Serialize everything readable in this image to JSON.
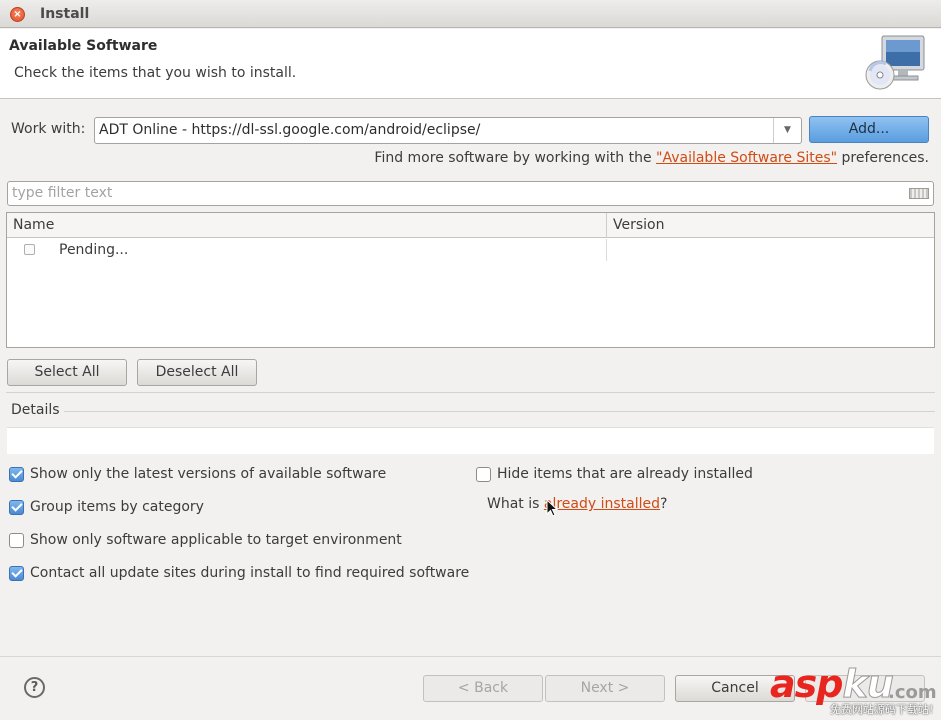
{
  "window": {
    "title": "Install"
  },
  "header": {
    "title": "Available Software",
    "description": "Check the items that you wish to install."
  },
  "work_with": {
    "label": "Work with:",
    "value": "ADT Online - https://dl-ssl.google.com/android/eclipse/",
    "add_button": "Add..."
  },
  "more_software": {
    "prefix": "Find more software by working with the ",
    "link": "\"Available Software Sites\"",
    "suffix": " preferences."
  },
  "filter": {
    "placeholder": "type filter text"
  },
  "table": {
    "columns": [
      "Name",
      "Version"
    ],
    "rows": [
      {
        "name": "Pending...",
        "version": ""
      }
    ]
  },
  "selection_buttons": {
    "select_all": "Select All",
    "deselect_all": "Deselect All"
  },
  "details": {
    "label": "Details"
  },
  "options": {
    "latest_versions": {
      "label": "Show only the latest versions of available software",
      "checked": true
    },
    "group_by_category": {
      "label": "Group items by category",
      "checked": true
    },
    "target_environment": {
      "label": "Show only software applicable to target environment",
      "checked": false
    },
    "contact_update_sites": {
      "label": "Contact all update sites during install to find required software",
      "checked": true
    },
    "hide_installed": {
      "label": "Hide items that are already installed",
      "checked": false
    }
  },
  "installed_query": {
    "prefix": "What is ",
    "link": "already installed",
    "suffix": "?"
  },
  "footer": {
    "help_icon": "question-mark-icon",
    "back": "< Back",
    "next": "Next >",
    "cancel": "Cancel"
  },
  "watermark": {
    "brand_a": "asp",
    "brand_b": "ku",
    "brand_c": ".com",
    "tagline": "免费网站源码下载站!"
  },
  "colors": {
    "primary_button": "#5a9de0",
    "link": "#d14b14",
    "checkbox_on": "#4a8ad6"
  }
}
